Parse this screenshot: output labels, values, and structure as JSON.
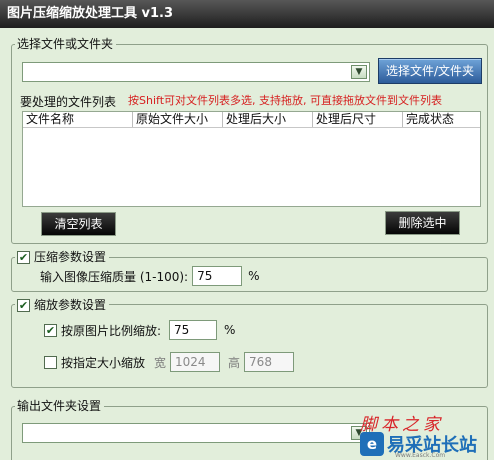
{
  "app": {
    "title": "图片压缩缩放处理工具 v1.3"
  },
  "file_group": {
    "title": "选择文件或文件夹",
    "path_value": "",
    "select_button": "选择文件/文件夹",
    "list_label": "要处理的文件列表",
    "hint": "按Shift可对文件列表多选, 支持拖放, 可直接拖放文件到文件列表",
    "columns": [
      "文件名称",
      "原始文件大小",
      "处理后大小",
      "处理后尺寸",
      "完成状态"
    ],
    "clear_button": "清空列表",
    "delete_button": "删除选中"
  },
  "compress_group": {
    "checkbox_label": "压缩参数设置",
    "checked": true,
    "quality_label": "输入图像压缩质量 (1-100):",
    "quality_value": "75",
    "unit": "%"
  },
  "scale_group": {
    "checkbox_label": "缩放参数设置",
    "checked": true,
    "ratio_label": "按原图片比例缩放:",
    "ratio_checked": true,
    "ratio_value": "75",
    "ratio_unit": "%",
    "size_label": "按指定大小缩放",
    "size_checked": false,
    "width_label": "宽",
    "width_value": "1024",
    "height_label": "高",
    "height_value": "768"
  },
  "output_group": {
    "title": "输出文件夹设置",
    "path_value": ""
  },
  "watermark": {
    "line1": "脚本之家",
    "line2": "易采站长站",
    "logo_glyph": "e",
    "url": "Www.Easck.Com"
  }
}
